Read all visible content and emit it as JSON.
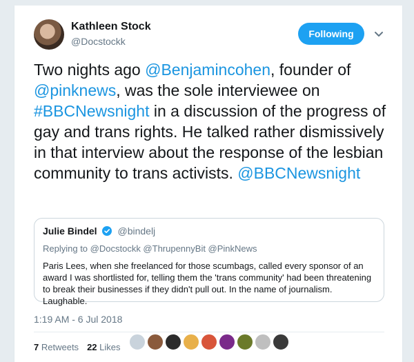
{
  "author": {
    "display_name": "Kathleen Stock",
    "handle": "@Docstockk"
  },
  "follow_button": {
    "label": "Following",
    "color": "#1da1f2"
  },
  "tweet": {
    "segments": [
      {
        "text": "Two nights ago ",
        "link": false
      },
      {
        "text": "@Benjamincohen",
        "link": true
      },
      {
        "text": ", founder of ",
        "link": false
      },
      {
        "text": "@pinknews",
        "link": true
      },
      {
        "text": ", was the sole interviewee on ",
        "link": false
      },
      {
        "text": "#BBCNewsnight",
        "link": true
      },
      {
        "text": " in a discussion of the progress of gay and trans rights. He talked rather dismissively in that interview about the response of the lesbian community to trans activists. ",
        "link": false
      },
      {
        "text": "@BBCNewsnight",
        "link": true
      }
    ]
  },
  "quote": {
    "display_name": "Julie Bindel",
    "handle": "@bindelj",
    "replying_prefix": "Replying to ",
    "replying_to": "@Docstockk @ThrupennyBit @PinkNews",
    "text": "Paris Lees, when she freelanced for those scumbags, called every sponsor of an award I was shortlisted for, telling them the 'trans community' had been threatening to break their businesses if they didn't pull out. In the name of journalism. Laughable."
  },
  "timestamp": "1:19 AM - 6 Jul 2018",
  "stats": {
    "retweets_count": "7",
    "retweets_label": "Retweets",
    "likes_count": "22",
    "likes_label": "Likes"
  },
  "liker_avatars": [
    {
      "name": "liker-avatar-1",
      "color": "#c9d3dc"
    },
    {
      "name": "liker-avatar-2",
      "color": "#8a5a3c"
    },
    {
      "name": "liker-avatar-3",
      "color": "#2b2b2b"
    },
    {
      "name": "liker-avatar-4",
      "color": "#e8b04a"
    },
    {
      "name": "liker-avatar-5",
      "color": "#d8553a"
    },
    {
      "name": "liker-avatar-6",
      "color": "#7a2a8a"
    },
    {
      "name": "liker-avatar-7",
      "color": "#6b7a2a"
    },
    {
      "name": "liker-avatar-8",
      "color": "#bfbfbf"
    },
    {
      "name": "liker-avatar-9",
      "color": "#3a3a3a"
    }
  ],
  "colors": {
    "link": "#1b95e0",
    "verified": "#1da1f2"
  }
}
